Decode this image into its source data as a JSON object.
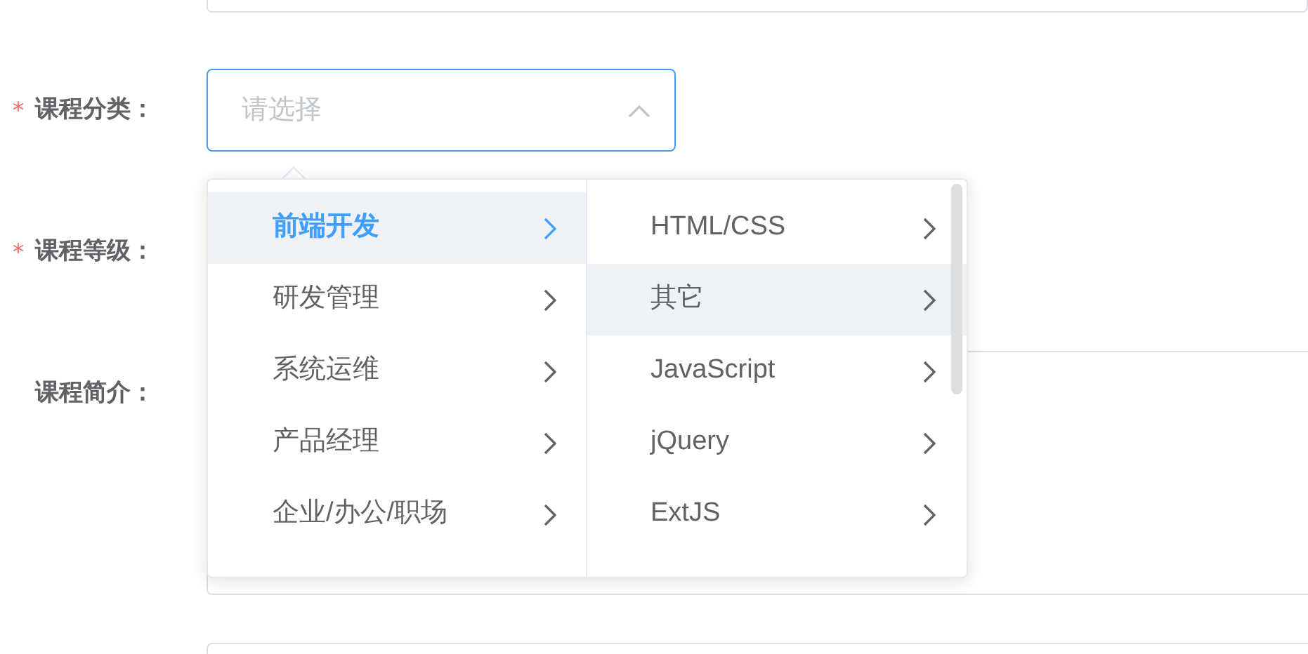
{
  "form": {
    "fields": [
      {
        "label": "课程分类：",
        "required_mark": "*",
        "kind": "select",
        "placeholder": "请选择",
        "expanded": true
      },
      {
        "label": "课程等级：",
        "required_mark": "*",
        "kind": "covered"
      },
      {
        "label": "课程简介：",
        "kind": "textarea"
      }
    ]
  },
  "cascader": {
    "columns": [
      {
        "items": [
          {
            "label": "前端开发",
            "selected": true,
            "highlighted": true
          },
          {
            "label": "研发管理",
            "selected": false,
            "highlighted": false
          },
          {
            "label": "系统运维",
            "selected": false,
            "highlighted": false
          },
          {
            "label": "产品经理",
            "selected": false,
            "highlighted": false
          },
          {
            "label": "企业/办公/职场",
            "selected": false,
            "highlighted": false
          }
        ]
      },
      {
        "items": [
          {
            "label": "HTML/CSS",
            "selected": false,
            "highlighted": false
          },
          {
            "label": "其它",
            "selected": false,
            "highlighted": true
          },
          {
            "label": "JavaScript",
            "selected": false,
            "highlighted": false
          },
          {
            "label": "jQuery",
            "selected": false,
            "highlighted": false
          },
          {
            "label": "ExtJS",
            "selected": false,
            "highlighted": false
          }
        ]
      }
    ]
  }
}
